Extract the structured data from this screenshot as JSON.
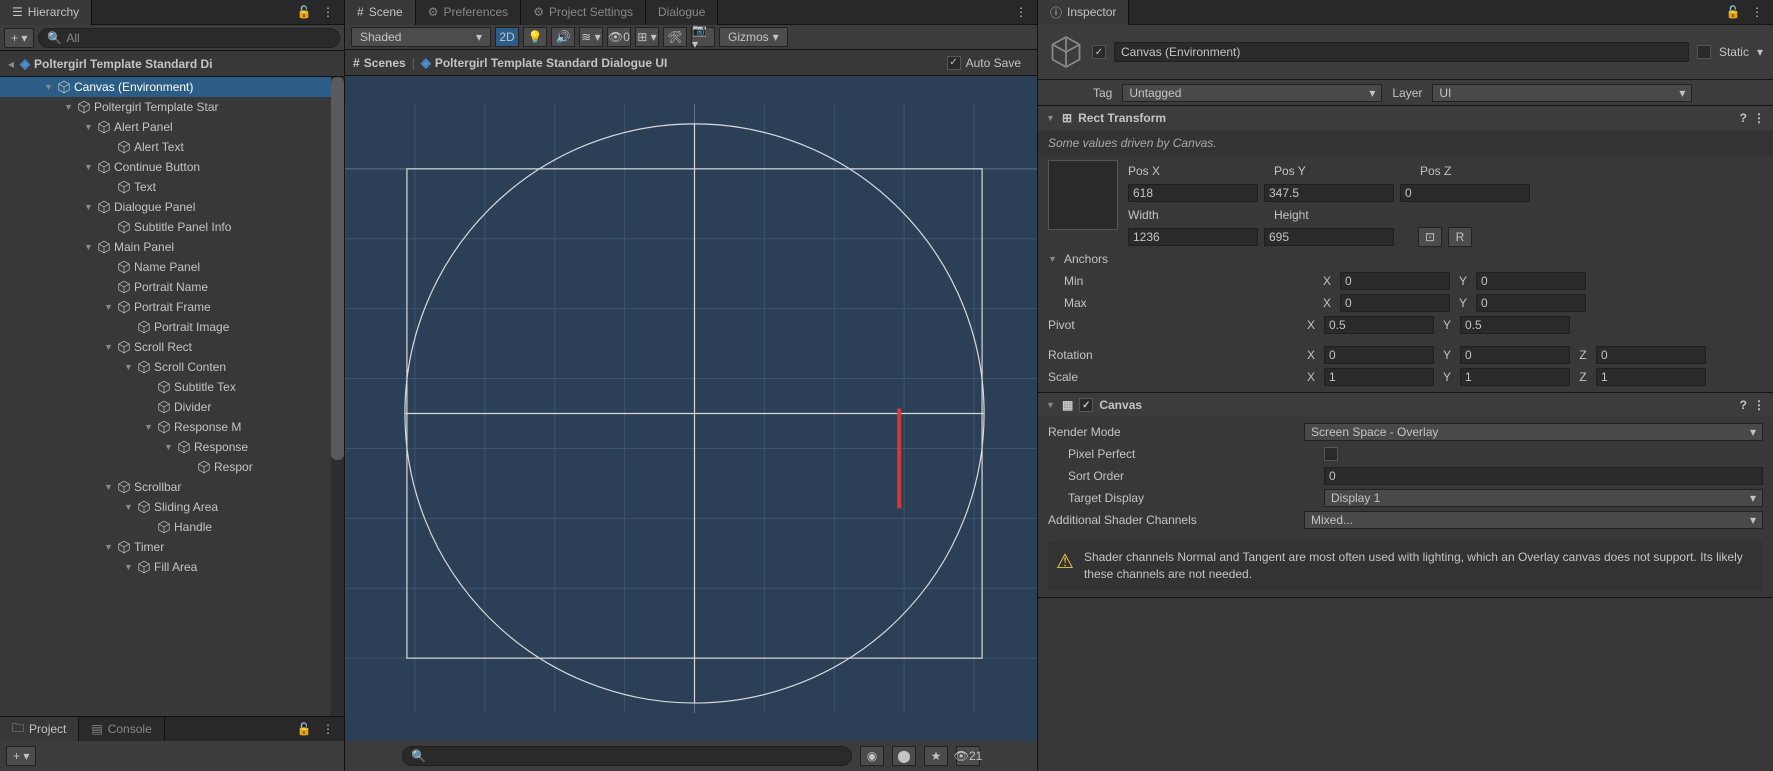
{
  "hierarchy": {
    "tab_label": "Hierarchy",
    "search_placeholder": "All",
    "root_scene": "Poltergirl Template Standard Di",
    "items": [
      {
        "label": "Canvas (Environment)",
        "depth": 0,
        "selected": true,
        "expanded": true
      },
      {
        "label": "Poltergirl Template Star",
        "depth": 1,
        "expanded": true
      },
      {
        "label": "Alert Panel",
        "depth": 2,
        "expanded": true
      },
      {
        "label": "Alert Text",
        "depth": 3
      },
      {
        "label": "Continue Button",
        "depth": 2,
        "expanded": true
      },
      {
        "label": "Text",
        "depth": 3
      },
      {
        "label": "Dialogue Panel",
        "depth": 2,
        "expanded": true
      },
      {
        "label": "Subtitle Panel Info",
        "depth": 3
      },
      {
        "label": "Main Panel",
        "depth": 2,
        "expanded": true
      },
      {
        "label": "Name Panel",
        "depth": 3
      },
      {
        "label": "Portrait Name",
        "depth": 3
      },
      {
        "label": "Portrait Frame",
        "depth": 3,
        "expanded": true
      },
      {
        "label": "Portrait Image",
        "depth": 4
      },
      {
        "label": "Scroll Rect",
        "depth": 3,
        "expanded": true
      },
      {
        "label": "Scroll Conten",
        "depth": 4,
        "expanded": true
      },
      {
        "label": "Subtitle Tex",
        "depth": 5
      },
      {
        "label": "Divider",
        "depth": 5
      },
      {
        "label": "Response M",
        "depth": 5,
        "expanded": true
      },
      {
        "label": "Response",
        "depth": 6,
        "expanded": true
      },
      {
        "label": "Respor",
        "depth": 7
      },
      {
        "label": "Scrollbar",
        "depth": 3,
        "expanded": true
      },
      {
        "label": "Sliding Area",
        "depth": 4,
        "expanded": true
      },
      {
        "label": "Handle",
        "depth": 5
      },
      {
        "label": "Timer",
        "depth": 3,
        "expanded": true
      },
      {
        "label": "Fill Area",
        "depth": 4,
        "expanded": true
      }
    ]
  },
  "project": {
    "tab_label": "Project"
  },
  "console": {
    "tab_label": "Console"
  },
  "scene": {
    "tabs": {
      "scene": "Scene",
      "preferences": "Preferences",
      "project_settings": "Project Settings",
      "dialogue": "Dialogue"
    },
    "shaded": "Shaded",
    "mode_2d": "2D",
    "off_badge": "0",
    "gizmos": "Gizmos",
    "scenes_label": "Scenes",
    "breadcrumb": "Poltergirl Template Standard Dialogue UI",
    "autosave": "Auto Save"
  },
  "inspector": {
    "tab_label": "Inspector",
    "static_label": "Static",
    "object_name": "Canvas (Environment)",
    "tag_label": "Tag",
    "tag_value": "Untagged",
    "layer_label": "Layer",
    "layer_value": "UI",
    "rect_transform": {
      "title": "Rect Transform",
      "info": "Some values driven by Canvas.",
      "posx_label": "Pos X",
      "posx": "618",
      "posy_label": "Pos Y",
      "posy": "347.5",
      "posz_label": "Pos Z",
      "posz": "0",
      "width_label": "Width",
      "width": "1236",
      "height_label": "Height",
      "height": "695",
      "anchors_label": "Anchors",
      "min_label": "Min",
      "min_x": "0",
      "min_y": "0",
      "max_label": "Max",
      "max_x": "0",
      "max_y": "0",
      "pivot_label": "Pivot",
      "pivot_x": "0.5",
      "pivot_y": "0.5",
      "rotation_label": "Rotation",
      "rot_x": "0",
      "rot_y": "0",
      "rot_z": "0",
      "scale_label": "Scale",
      "scale_x": "1",
      "scale_y": "1",
      "scale_z": "1",
      "x": "X",
      "y": "Y",
      "z": "Z",
      "r": "R"
    },
    "canvas": {
      "title": "Canvas",
      "render_mode_label": "Render Mode",
      "render_mode": "Screen Space - Overlay",
      "pixel_perfect_label": "Pixel Perfect",
      "sort_order_label": "Sort Order",
      "sort_order": "0",
      "target_display_label": "Target Display",
      "target_display": "Display 1",
      "shader_channels_label": "Additional Shader Channels",
      "shader_channels": "Mixed...",
      "warning": "Shader channels Normal and Tangent are most often used with lighting, which an Overlay canvas does not support. Its likely these channels are not needed."
    }
  },
  "footer": {
    "items_count": "21"
  }
}
